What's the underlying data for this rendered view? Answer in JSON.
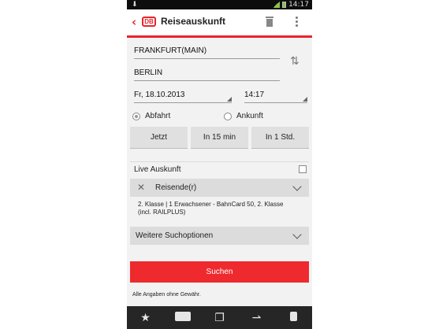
{
  "status_bar": {
    "time": "14:17"
  },
  "header": {
    "title": "Reiseauskunft",
    "logo_text": "DB"
  },
  "route": {
    "from": "FRANKFURT(MAIN)",
    "to": "BERLIN"
  },
  "datetime": {
    "date": "Fr, 18.10.2013",
    "time": "14:17"
  },
  "mode": {
    "departure_label": "Abfahrt",
    "arrival_label": "Ankunft",
    "selected": "Abfahrt"
  },
  "quick_buttons": {
    "now": "Jetzt",
    "in_15": "In 15 min",
    "in_60": "In 1 Std."
  },
  "live": {
    "label": "Live Auskunft",
    "checked": false
  },
  "travellers": {
    "label": "Reisende(r)",
    "details": "2. Klasse  |  1 Erwachsener - BahnCard 50, 2. Klasse (incl. RAILPLUS)"
  },
  "more_options": {
    "label": "Weitere Suchoptionen"
  },
  "search": {
    "label": "Suchen"
  },
  "disclaimer": "Alle Angaben ohne Gewähr.",
  "colors": {
    "accent": "#e9242c",
    "button": "#ee2a2e",
    "panel": "#dcdcdc",
    "bottombar": "#262626"
  },
  "bottom_nav": [
    "star-icon",
    "train-icon",
    "ticket-icon",
    "car-icon",
    "document-icon"
  ]
}
